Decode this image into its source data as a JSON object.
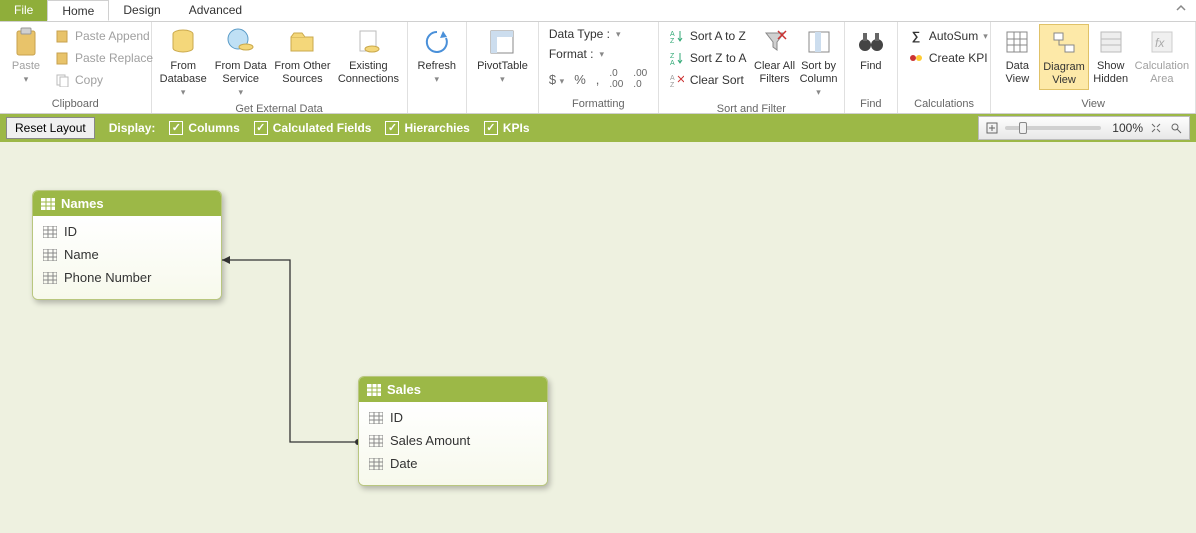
{
  "tabs": {
    "file": "File",
    "home": "Home",
    "design": "Design",
    "advanced": "Advanced"
  },
  "ribbon": {
    "clipboard": {
      "label": "Clipboard",
      "paste": "Paste",
      "pasteAppend": "Paste Append",
      "pasteReplace": "Paste Replace",
      "copy": "Copy"
    },
    "getdata": {
      "label": "Get External Data",
      "fromDatabase": "From\nDatabase",
      "fromDataService": "From Data\nService",
      "fromOther": "From Other\nSources",
      "existing": "Existing\nConnections"
    },
    "refresh": "Refresh",
    "pivot": "PivotTable",
    "formatting": {
      "label": "Formatting",
      "dataType": "Data Type :",
      "format": "Format :"
    },
    "sortfilter": {
      "label": "Sort and Filter",
      "az": "Sort A to Z",
      "za": "Sort Z to A",
      "clearSort": "Clear Sort",
      "clearAll": "Clear All\nFilters",
      "sortBy": "Sort by\nColumn"
    },
    "find": {
      "label": "Find",
      "find": "Find"
    },
    "calc": {
      "label": "Calculations",
      "autosum": "AutoSum",
      "createKpi": "Create KPI"
    },
    "view": {
      "label": "View",
      "dataView": "Data\nView",
      "diagramView": "Diagram\nView",
      "showHidden": "Show\nHidden",
      "calcArea": "Calculation\nArea"
    }
  },
  "displayBar": {
    "reset": "Reset Layout",
    "display": "Display:",
    "columns": "Columns",
    "calcFields": "Calculated Fields",
    "hierarchies": "Hierarchies",
    "kpis": "KPIs",
    "zoom": "100%"
  },
  "tables": {
    "names": {
      "title": "Names",
      "fields": [
        "ID",
        "Name",
        "Phone Number"
      ]
    },
    "sales": {
      "title": "Sales",
      "fields": [
        "ID",
        "Sales Amount",
        "Date"
      ]
    }
  }
}
